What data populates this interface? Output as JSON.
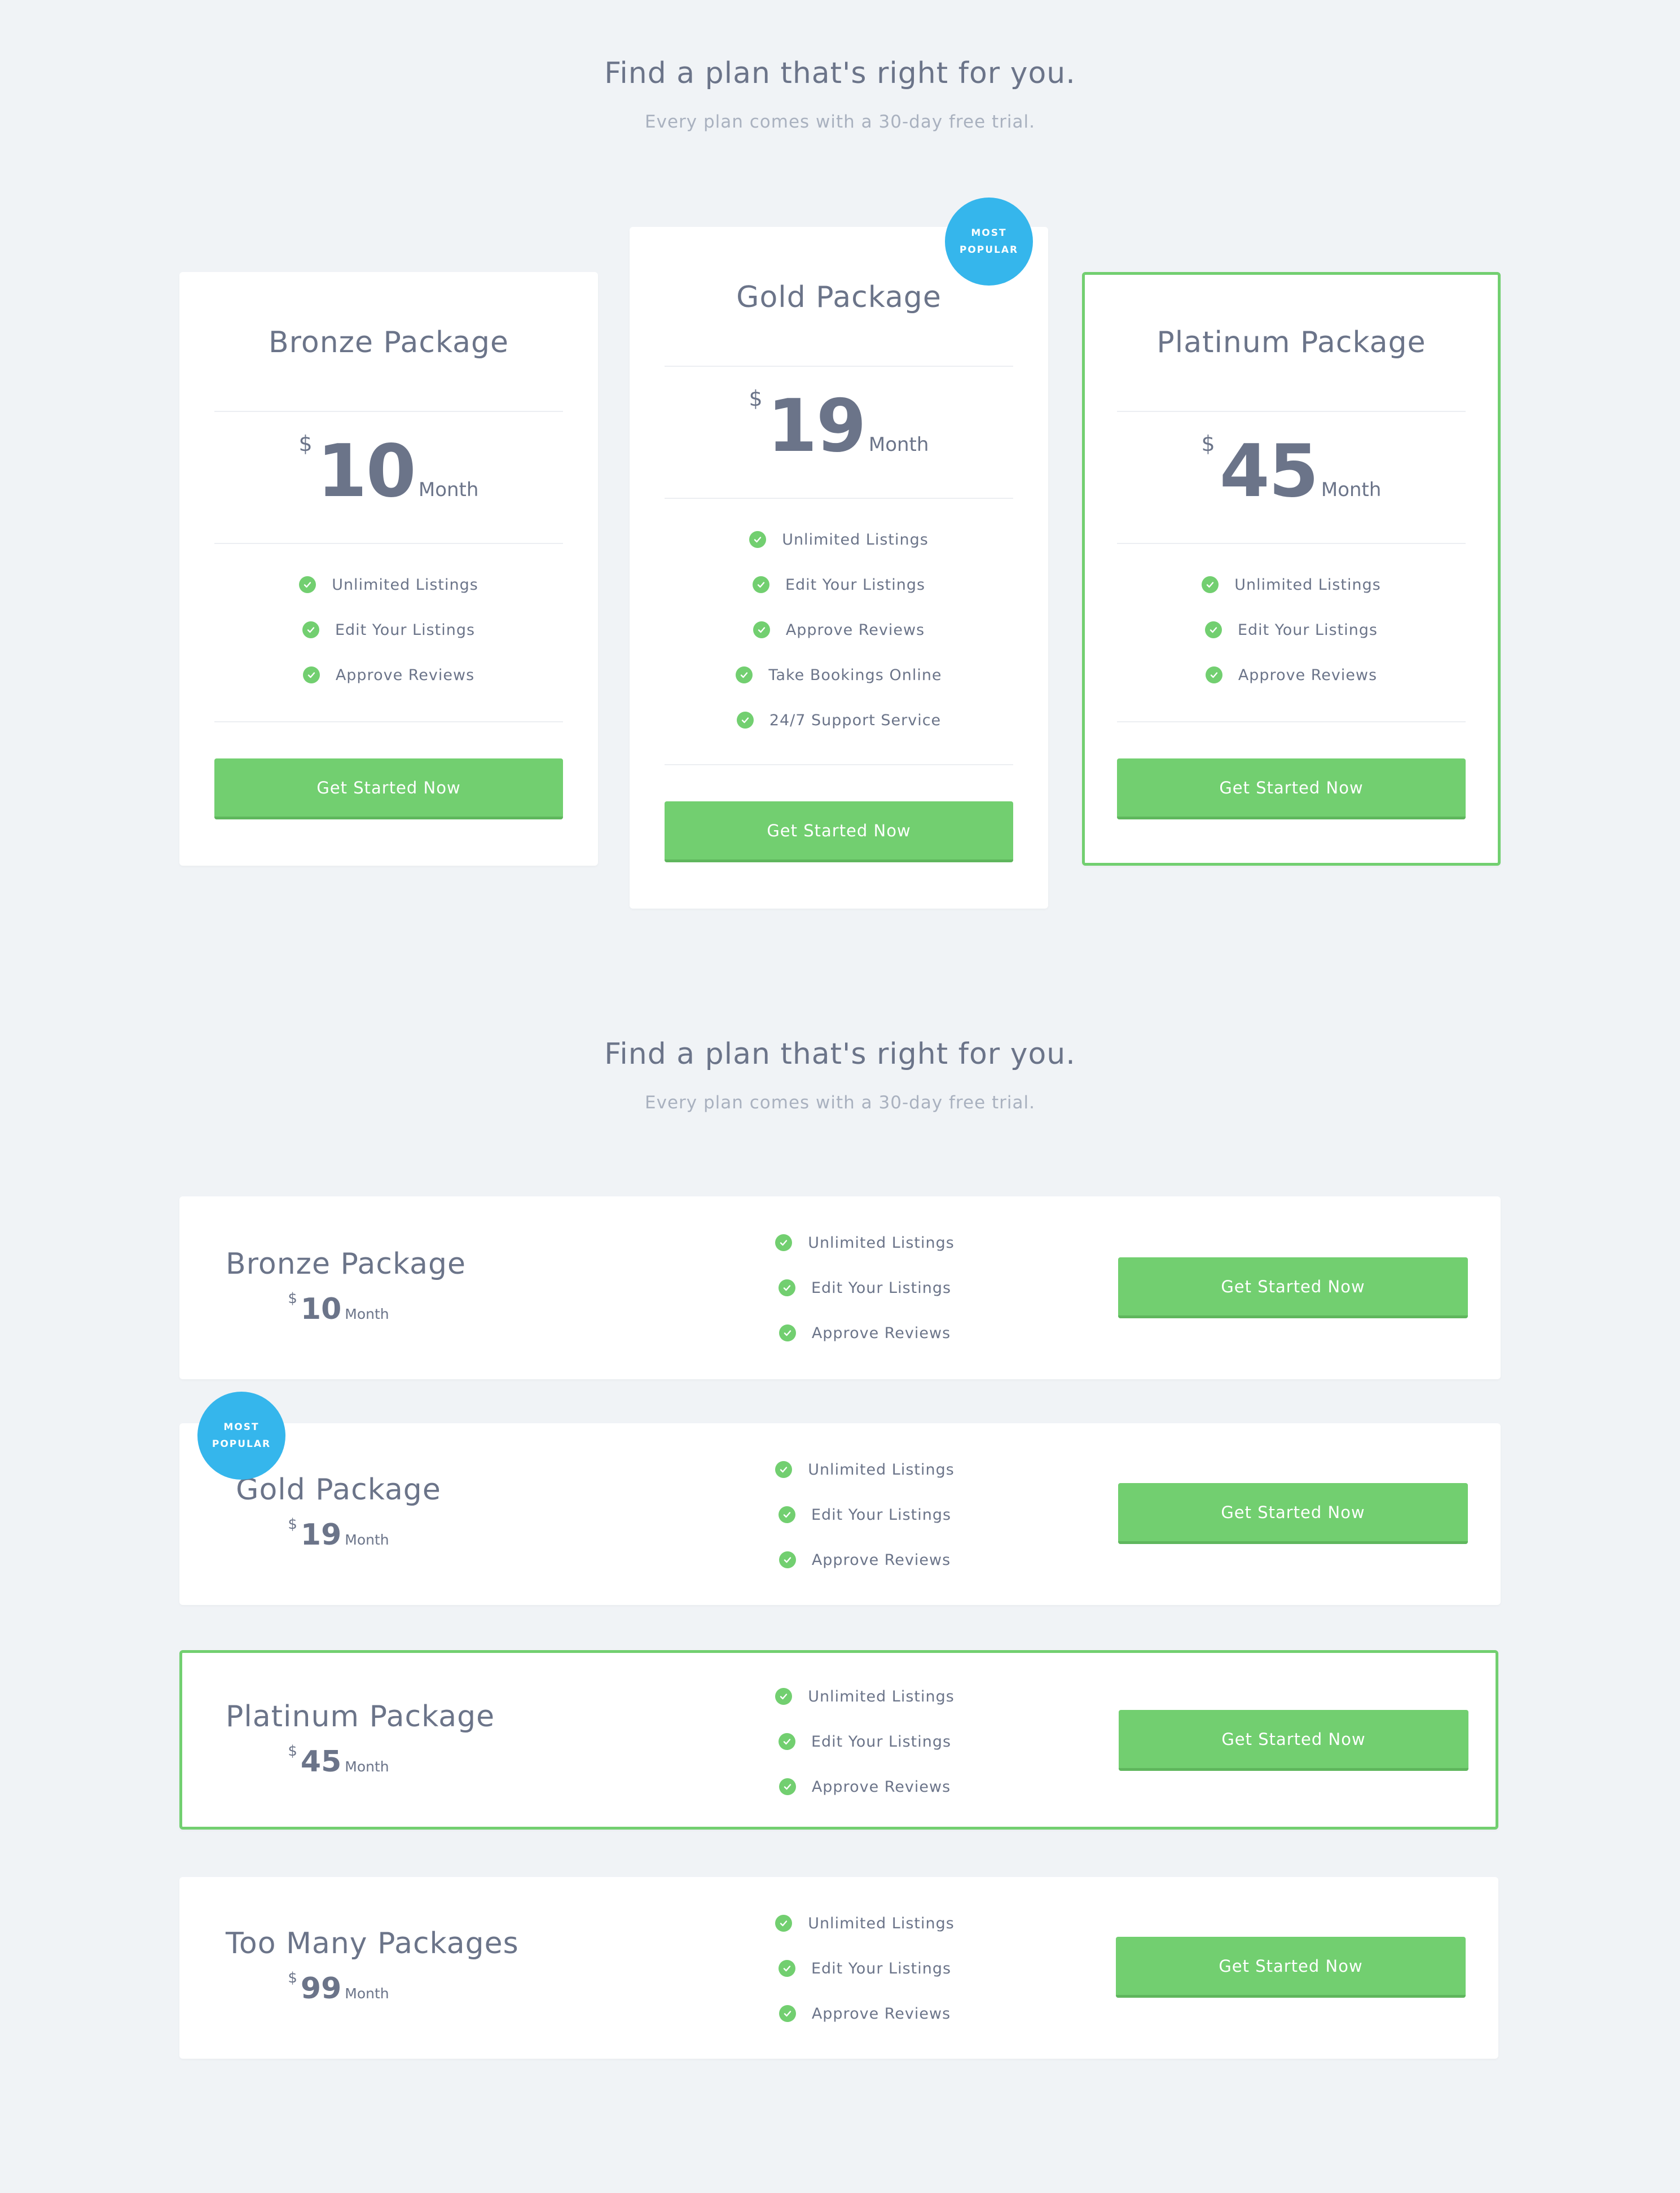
{
  "section1": {
    "title": "Find a plan that's right for you.",
    "subtitle": "Every plan comes with a 30-day free trial.",
    "plans": [
      {
        "name": "Bronze Package",
        "currency": "$",
        "price": "10",
        "period": "Month",
        "features": [
          "Unlimited Listings",
          "Edit Your Listings",
          "Approve Reviews"
        ],
        "cta": "Get Started Now"
      },
      {
        "name": "Gold Package",
        "badge_line1": "MOST",
        "badge_line2": "POPULAR",
        "currency": "$",
        "price": "19",
        "period": "Month",
        "features": [
          "Unlimited Listings",
          "Edit Your Listings",
          "Approve Reviews",
          "Take Bookings Online",
          "24/7 Support Service"
        ],
        "cta": "Get Started Now"
      },
      {
        "name": "Platinum Package",
        "currency": "$",
        "price": "45",
        "period": "Month",
        "features": [
          "Unlimited Listings",
          "Edit Your Listings",
          "Approve Reviews"
        ],
        "cta": "Get Started Now"
      }
    ]
  },
  "section2": {
    "title": "Find a plan that's right for you.",
    "subtitle": "Every plan comes with a 30-day free trial.",
    "plans": [
      {
        "name": "Bronze Package",
        "currency": "$",
        "price": "10",
        "period": "Month",
        "features": [
          "Unlimited Listings",
          "Edit Your Listings",
          "Approve Reviews"
        ],
        "cta": "Get Started Now"
      },
      {
        "name": "Gold Package",
        "badge_line1": "MOST",
        "badge_line2": "POPULAR",
        "currency": "$",
        "price": "19",
        "period": "Month",
        "features": [
          "Unlimited Listings",
          "Edit Your Listings",
          "Approve Reviews"
        ],
        "cta": "Get Started Now"
      },
      {
        "name": "Platinum Package",
        "currency": "$",
        "price": "45",
        "period": "Month",
        "features": [
          "Unlimited Listings",
          "Edit Your Listings",
          "Approve Reviews"
        ],
        "cta": "Get Started Now"
      },
      {
        "name": "Too Many Packages",
        "currency": "$",
        "price": "99",
        "period": "Month",
        "features": [
          "Unlimited Listings",
          "Edit Your Listings",
          "Approve Reviews"
        ],
        "cta": "Get Started Now"
      }
    ]
  },
  "colors": {
    "background": "#f0f3f6",
    "accent_green": "#72cf70",
    "badge_blue": "#35b6ec",
    "text": "#6b7489"
  },
  "icons": {
    "feature": "check-circle-icon"
  }
}
